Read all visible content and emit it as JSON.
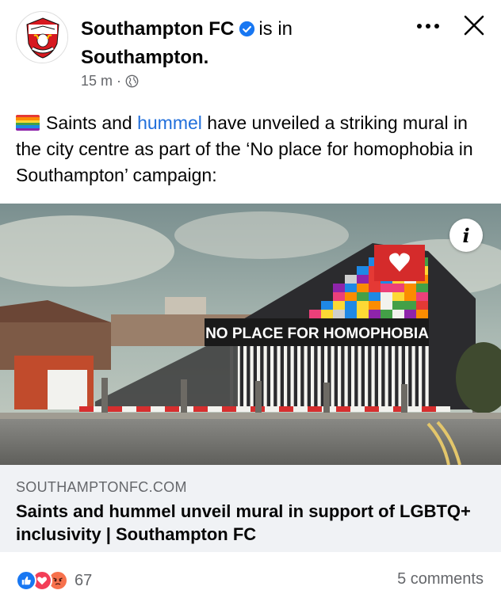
{
  "post": {
    "page_name": "Southampton FC",
    "is_in": "is in",
    "location": "Southampton.",
    "time": "15 m",
    "meta_separator": "·",
    "text_before_link": "Saints and ",
    "text_link": "hummel",
    "text_after_link": " have unveiled a striking mural in the city centre as part of the ‘No place for homophobia in Southampton’ campaign:",
    "rainbow_colors": [
      "#e53935",
      "#fb8c00",
      "#fdd835",
      "#43a047",
      "#1e88e5",
      "#8e24aa"
    ]
  },
  "link_preview": {
    "domain": "SOUTHAMPTONFC.COM",
    "title": "Saints and hummel unveil mural in support of LGBTQ+ inclusivity | Southampton FC",
    "image_sign_text": "NO PLACE FOR HOMOPHOBIA"
  },
  "footer": {
    "reaction_count": "67",
    "comments": "5 comments"
  },
  "icons": {
    "verified": "verified-badge-icon",
    "globe": "globe-icon",
    "more": "more-dots-icon",
    "close": "close-icon",
    "info": "info-icon",
    "like": "like-reaction-icon",
    "love": "love-reaction-icon",
    "angry": "angry-reaction-icon"
  },
  "colors": {
    "brand_blue": "#1877f2",
    "link_blue": "#216fdb",
    "secondary_text": "#65676b",
    "footer_bg": "#f0f2f5",
    "love_red": "#f33e58",
    "angry_orange": "#f7714c"
  }
}
